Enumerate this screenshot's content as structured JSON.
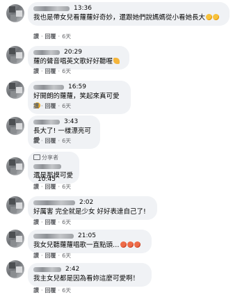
{
  "comments": [
    {
      "time": "13:36",
      "text": "我也是帶女兒看蘿蘿好奇妙，還跟她們說媽媽從小看她長大",
      "emoji": [
        "yellow",
        "yellow"
      ],
      "like": "讚",
      "reply": "回覆",
      "age": "6天"
    },
    {
      "time": "20:29",
      "text": "蘿的聲音唱英文歌好好聽喔",
      "emoji": [
        "thumb"
      ],
      "like": "讚",
      "reply": "回覆",
      "age": "6天"
    },
    {
      "time": "16:59",
      "text": "好開朗的蘿蘿，笑起來真可愛",
      "emoji": [
        "yellow"
      ],
      "like": "讚",
      "reply": "回覆",
      "age": "6天"
    },
    {
      "time": "3:43",
      "text": "長大了! 一樣漂亮可愛",
      "emoji": [],
      "like": "讚",
      "reply": "回覆",
      "age": "6天"
    },
    {
      "time": "10:45",
      "share": "分享者",
      "text": "還是那摸可愛",
      "emoji": [],
      "like": "讚",
      "reply": "回覆",
      "age": "6天"
    },
    {
      "time": "2:02",
      "text": "好厲害 完全就是少女 好好表達自己了!",
      "emoji": [],
      "like": "讚",
      "reply": "回覆",
      "age": "6天"
    },
    {
      "time": "21:05",
      "text": "我女兒聽蘿蘿唱歌一直點頭…",
      "emoji": [
        "heart",
        "heart",
        "heart"
      ],
      "like": "讚",
      "reply": "回覆",
      "age": "6天"
    },
    {
      "time": "2:42",
      "text": "我主女兒都是因為看妳這麼可愛啊！",
      "emoji": [],
      "like": "讚",
      "reply": "回覆",
      "age": "6天"
    }
  ]
}
